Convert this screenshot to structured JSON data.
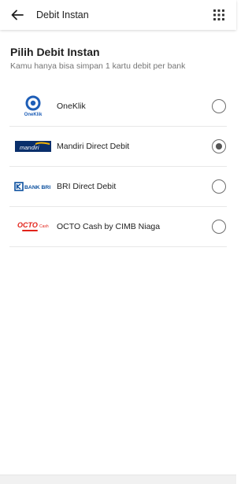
{
  "topbar": {
    "title": "Debit Instan",
    "back_icon": "arrow-left-icon",
    "menu_icon": "apps-grid-icon"
  },
  "header": {
    "title": "Pilih Debit Instan",
    "subtitle": "Kamu hanya bisa simpan 1 kartu debit per bank"
  },
  "options": [
    {
      "label": "OneKlik",
      "logo_text": "OneKlik",
      "logo_icon": "oneklik-logo",
      "selected": false
    },
    {
      "label": "Mandiri Direct Debit",
      "logo_text": "mandiri",
      "logo_icon": "mandiri-logo",
      "selected": true
    },
    {
      "label": "BRI Direct Debit",
      "logo_text": "BANK BRI",
      "logo_icon": "bri-logo",
      "selected": false
    },
    {
      "label": "OCTO Cash by CIMB Niaga",
      "logo_text": "OCTO",
      "logo_subtext": "Cash",
      "logo_icon": "octo-cash-logo",
      "selected": false
    }
  ],
  "colors": {
    "text_primary": "#212121",
    "text_secondary": "#757575",
    "oneklik_blue": "#1e5eb7",
    "mandiri_navy": "#0a2f6b",
    "mandiri_gold": "#f4b400",
    "bri_blue": "#0a4f9e",
    "octo_red": "#e2231a",
    "radio_border": "#6d6d6d"
  }
}
